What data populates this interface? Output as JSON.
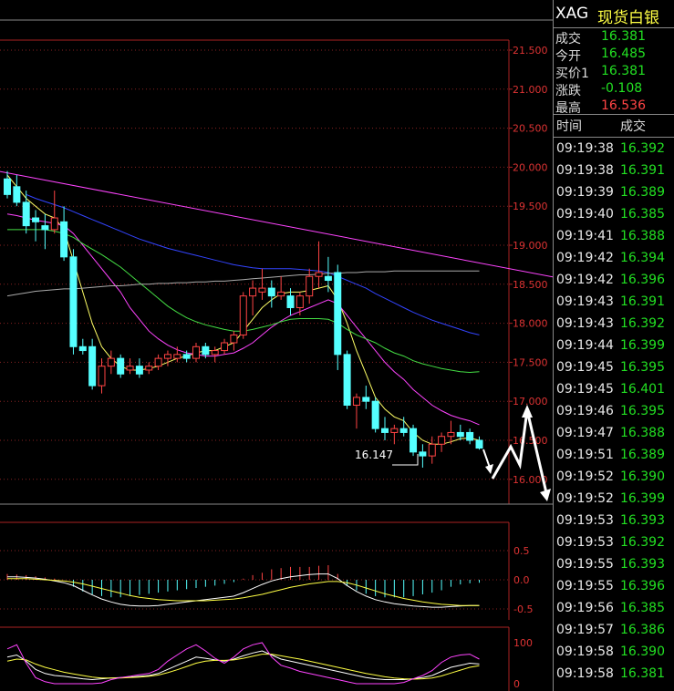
{
  "header": {
    "symbol": "XAG",
    "name": "现货白银"
  },
  "quote": [
    {
      "label": "成交",
      "value": "16.381",
      "color": "#22e022"
    },
    {
      "label": "今开",
      "value": "16.485",
      "color": "#22e022"
    },
    {
      "label": "买价1",
      "value": "16.381",
      "color": "#22e022"
    },
    {
      "label": "涨跌",
      "value": "-0.108",
      "color": "#22e022"
    },
    {
      "label": "最高",
      "value": "16.536",
      "color": "#ff4444"
    }
  ],
  "ticks_header": {
    "time": "时间",
    "price": "成交"
  },
  "ticks": [
    {
      "time": "09:19:38",
      "price": "16.392"
    },
    {
      "time": "09:19:38",
      "price": "16.391"
    },
    {
      "time": "09:19:39",
      "price": "16.389"
    },
    {
      "time": "09:19:40",
      "price": "16.385"
    },
    {
      "time": "09:19:41",
      "price": "16.388"
    },
    {
      "time": "09:19:42",
      "price": "16.394"
    },
    {
      "time": "09:19:42",
      "price": "16.396"
    },
    {
      "time": "09:19:43",
      "price": "16.391"
    },
    {
      "time": "09:19:43",
      "price": "16.392"
    },
    {
      "time": "09:19:44",
      "price": "16.399"
    },
    {
      "time": "09:19:45",
      "price": "16.395"
    },
    {
      "time": "09:19:45",
      "price": "16.401"
    },
    {
      "time": "09:19:46",
      "price": "16.395"
    },
    {
      "time": "09:19:47",
      "price": "16.388"
    },
    {
      "time": "09:19:51",
      "price": "16.389"
    },
    {
      "time": "09:19:52",
      "price": "16.390"
    },
    {
      "time": "09:19:52",
      "price": "16.399"
    },
    {
      "time": "09:19:53",
      "price": "16.393"
    },
    {
      "time": "09:19:53",
      "price": "16.392"
    },
    {
      "time": "09:19:55",
      "price": "16.393"
    },
    {
      "time": "09:19:55",
      "price": "16.396"
    },
    {
      "time": "09:19:56",
      "price": "16.385"
    },
    {
      "time": "09:19:57",
      "price": "16.386"
    },
    {
      "time": "09:19:58",
      "price": "16.390"
    },
    {
      "time": "09:19:58",
      "price": "16.381"
    }
  ],
  "chart_data": {
    "type": "candlestick",
    "yticks": [
      "21.500",
      "21.000",
      "20.500",
      "20.000",
      "19.500",
      "19.000",
      "18.500",
      "18.000",
      "17.500",
      "17.000",
      "16.500",
      "16.000"
    ],
    "ylim": [
      15.7,
      21.6
    ],
    "annotation": "16.147",
    "up_color": "#ff4444",
    "down_color": "#55ffff",
    "candles": [
      {
        "o": 19.85,
        "h": 19.95,
        "l": 19.6,
        "c": 19.65
      },
      {
        "o": 19.75,
        "h": 19.9,
        "l": 19.5,
        "c": 19.55
      },
      {
        "o": 19.55,
        "h": 19.7,
        "l": 19.15,
        "c": 19.25
      },
      {
        "o": 19.35,
        "h": 19.45,
        "l": 19.05,
        "c": 19.3
      },
      {
        "o": 19.25,
        "h": 19.4,
        "l": 18.95,
        "c": 19.2
      },
      {
        "o": 19.2,
        "h": 19.7,
        "l": 19.15,
        "c": 19.35
      },
      {
        "o": 19.3,
        "h": 19.5,
        "l": 18.8,
        "c": 18.85
      },
      {
        "o": 18.85,
        "h": 18.95,
        "l": 17.6,
        "c": 17.7
      },
      {
        "o": 17.7,
        "h": 17.8,
        "l": 17.6,
        "c": 17.65
      },
      {
        "o": 17.7,
        "h": 17.8,
        "l": 17.15,
        "c": 17.2
      },
      {
        "o": 17.2,
        "h": 17.55,
        "l": 17.1,
        "c": 17.45
      },
      {
        "o": 17.45,
        "h": 17.65,
        "l": 17.35,
        "c": 17.55
      },
      {
        "o": 17.55,
        "h": 17.6,
        "l": 17.3,
        "c": 17.35
      },
      {
        "o": 17.4,
        "h": 17.55,
        "l": 17.35,
        "c": 17.45
      },
      {
        "o": 17.45,
        "h": 17.55,
        "l": 17.3,
        "c": 17.35
      },
      {
        "o": 17.4,
        "h": 17.5,
        "l": 17.35,
        "c": 17.45
      },
      {
        "o": 17.45,
        "h": 17.6,
        "l": 17.4,
        "c": 17.55
      },
      {
        "o": 17.55,
        "h": 17.65,
        "l": 17.45,
        "c": 17.6
      },
      {
        "o": 17.55,
        "h": 17.7,
        "l": 17.5,
        "c": 17.6
      },
      {
        "o": 17.6,
        "h": 17.65,
        "l": 17.5,
        "c": 17.55
      },
      {
        "o": 17.55,
        "h": 17.75,
        "l": 17.5,
        "c": 17.7
      },
      {
        "o": 17.7,
        "h": 17.75,
        "l": 17.55,
        "c": 17.6
      },
      {
        "o": 17.6,
        "h": 17.7,
        "l": 17.5,
        "c": 17.65
      },
      {
        "o": 17.65,
        "h": 17.8,
        "l": 17.6,
        "c": 17.75
      },
      {
        "o": 17.75,
        "h": 17.9,
        "l": 17.65,
        "c": 17.85
      },
      {
        "o": 17.85,
        "h": 18.4,
        "l": 17.8,
        "c": 18.35
      },
      {
        "o": 18.35,
        "h": 18.55,
        "l": 18.1,
        "c": 18.45
      },
      {
        "o": 18.4,
        "h": 18.7,
        "l": 18.3,
        "c": 18.45
      },
      {
        "o": 18.45,
        "h": 18.55,
        "l": 18.2,
        "c": 18.35
      },
      {
        "o": 18.35,
        "h": 18.6,
        "l": 18.3,
        "c": 18.4
      },
      {
        "o": 18.35,
        "h": 18.45,
        "l": 18.1,
        "c": 18.2
      },
      {
        "o": 18.2,
        "h": 18.4,
        "l": 18.1,
        "c": 18.35
      },
      {
        "o": 18.35,
        "h": 18.7,
        "l": 18.25,
        "c": 18.6
      },
      {
        "o": 18.6,
        "h": 19.05,
        "l": 18.45,
        "c": 18.65
      },
      {
        "o": 18.6,
        "h": 18.85,
        "l": 18.4,
        "c": 18.55
      },
      {
        "o": 18.65,
        "h": 18.75,
        "l": 17.4,
        "c": 17.6
      },
      {
        "o": 17.6,
        "h": 17.65,
        "l": 16.9,
        "c": 16.95
      },
      {
        "o": 16.95,
        "h": 17.1,
        "l": 16.65,
        "c": 17.05
      },
      {
        "o": 17.05,
        "h": 17.2,
        "l": 16.9,
        "c": 17.0
      },
      {
        "o": 17.0,
        "h": 17.05,
        "l": 16.6,
        "c": 16.65
      },
      {
        "o": 16.65,
        "h": 16.8,
        "l": 16.5,
        "c": 16.6
      },
      {
        "o": 16.6,
        "h": 16.7,
        "l": 16.45,
        "c": 16.65
      },
      {
        "o": 16.65,
        "h": 16.8,
        "l": 16.55,
        "c": 16.6
      },
      {
        "o": 16.65,
        "h": 16.7,
        "l": 16.3,
        "c": 16.35
      },
      {
        "o": 16.35,
        "h": 16.45,
        "l": 16.15,
        "c": 16.3
      },
      {
        "o": 16.3,
        "h": 16.55,
        "l": 16.2,
        "c": 16.45
      },
      {
        "o": 16.45,
        "h": 16.6,
        "l": 16.35,
        "c": 16.55
      },
      {
        "o": 16.55,
        "h": 16.75,
        "l": 16.45,
        "c": 16.6
      },
      {
        "o": 16.6,
        "h": 16.7,
        "l": 16.5,
        "c": 16.55
      },
      {
        "o": 16.6,
        "h": 16.65,
        "l": 16.45,
        "c": 16.5
      },
      {
        "o": 16.5,
        "h": 16.55,
        "l": 16.38,
        "c": 16.4
      }
    ],
    "ma": [
      {
        "color": "#ffff66",
        "values": [
          19.9,
          19.75,
          19.6,
          19.5,
          19.4,
          19.35,
          19.2,
          18.8,
          18.4,
          18.0,
          17.7,
          17.55,
          17.45,
          17.4,
          17.4,
          17.42,
          17.45,
          17.5,
          17.55,
          17.58,
          17.62,
          17.65,
          17.65,
          17.7,
          17.75,
          17.9,
          18.05,
          18.2,
          18.3,
          18.38,
          18.4,
          18.4,
          18.42,
          18.45,
          18.48,
          18.3,
          18.0,
          17.65,
          17.35,
          17.05,
          16.9,
          16.8,
          16.75,
          16.6,
          16.5,
          16.45,
          16.45,
          16.48,
          16.52,
          16.53,
          16.5
        ]
      },
      {
        "color": "#ff44ff",
        "values": [
          19.4,
          19.38,
          19.35,
          19.32,
          19.3,
          19.28,
          19.25,
          19.15,
          19.0,
          18.85,
          18.7,
          18.55,
          18.4,
          18.2,
          18.05,
          17.9,
          17.8,
          17.72,
          17.66,
          17.62,
          17.6,
          17.58,
          17.58,
          17.6,
          17.62,
          17.68,
          17.75,
          17.85,
          17.95,
          18.03,
          18.1,
          18.15,
          18.2,
          18.25,
          18.3,
          18.25,
          18.1,
          17.95,
          17.8,
          17.65,
          17.5,
          17.38,
          17.28,
          17.15,
          17.05,
          16.95,
          16.88,
          16.82,
          16.78,
          16.75,
          16.7
        ]
      },
      {
        "color": "#44dd44",
        "values": [
          19.2,
          19.2,
          19.2,
          19.2,
          19.2,
          19.18,
          19.15,
          19.1,
          19.02,
          18.95,
          18.88,
          18.8,
          18.72,
          18.62,
          18.52,
          18.42,
          18.32,
          18.22,
          18.14,
          18.07,
          18.02,
          17.98,
          17.95,
          17.92,
          17.9,
          17.9,
          17.92,
          17.95,
          17.98,
          18.02,
          18.05,
          18.06,
          18.06,
          18.06,
          18.05,
          18.0,
          17.92,
          17.85,
          17.8,
          17.75,
          17.68,
          17.62,
          17.58,
          17.52,
          17.48,
          17.45,
          17.42,
          17.4,
          17.38,
          17.37,
          17.38
        ]
      },
      {
        "color": "#3344ff",
        "values": [
          null,
          null,
          19.65,
          19.6,
          19.56,
          19.52,
          19.48,
          19.43,
          19.38,
          19.33,
          19.28,
          19.23,
          19.18,
          19.13,
          19.08,
          19.04,
          19.0,
          18.96,
          18.93,
          18.9,
          18.87,
          18.84,
          18.81,
          18.78,
          18.75,
          18.73,
          18.71,
          18.7,
          18.7,
          18.7,
          18.7,
          18.69,
          18.68,
          18.67,
          18.65,
          18.6,
          18.55,
          18.5,
          18.45,
          18.38,
          18.32,
          18.26,
          18.2,
          18.14,
          18.09,
          18.04,
          18.0,
          17.96,
          17.92,
          17.88,
          17.85
        ]
      },
      {
        "color": "#aaaaaa",
        "values": [
          18.35,
          18.37,
          18.39,
          18.41,
          18.42,
          18.43,
          18.44,
          18.44,
          18.45,
          18.46,
          18.47,
          18.48,
          18.48,
          18.49,
          18.5,
          18.5,
          18.51,
          18.51,
          18.52,
          18.52,
          18.53,
          18.53,
          18.54,
          18.54,
          18.55,
          18.56,
          18.57,
          18.58,
          18.59,
          18.6,
          18.61,
          18.62,
          18.62,
          18.63,
          18.64,
          18.64,
          18.65,
          18.65,
          18.66,
          18.66,
          18.66,
          18.67,
          18.67,
          18.67,
          18.67,
          18.67,
          18.67,
          18.67,
          18.67,
          18.67,
          18.67
        ]
      }
    ],
    "trendline": {
      "color": "#ff44ff",
      "points": [
        [
          -1,
          19.95
        ],
        [
          64,
          18.45
        ]
      ]
    },
    "macd": {
      "yticks": [
        "0.5",
        "0.0",
        "-0.5"
      ],
      "ylim": [
        -0.6,
        0.65
      ],
      "hist": [
        0.1,
        0.09,
        0.08,
        0.06,
        0.04,
        0.02,
        0.0,
        -0.12,
        -0.2,
        -0.25,
        -0.28,
        -0.3,
        -0.3,
        -0.28,
        -0.26,
        -0.24,
        -0.22,
        -0.2,
        -0.18,
        -0.16,
        -0.14,
        -0.12,
        -0.1,
        -0.07,
        -0.04,
        0.02,
        0.08,
        0.12,
        0.18,
        0.2,
        0.22,
        0.22,
        0.22,
        0.24,
        0.25,
        0.1,
        -0.1,
        -0.18,
        -0.24,
        -0.28,
        -0.3,
        -0.3,
        -0.3,
        -0.28,
        -0.25,
        -0.22,
        -0.18,
        -0.12,
        -0.08,
        -0.06,
        -0.05
      ],
      "dif": [
        0.05,
        0.05,
        0.04,
        0.03,
        0.01,
        -0.02,
        -0.05,
        -0.1,
        -0.18,
        -0.26,
        -0.33,
        -0.38,
        -0.42,
        -0.44,
        -0.45,
        -0.45,
        -0.44,
        -0.42,
        -0.4,
        -0.38,
        -0.36,
        -0.34,
        -0.32,
        -0.3,
        -0.28,
        -0.22,
        -0.15,
        -0.08,
        -0.02,
        0.02,
        0.05,
        0.07,
        0.09,
        0.1,
        0.1,
        0.02,
        -0.1,
        -0.2,
        -0.28,
        -0.34,
        -0.38,
        -0.41,
        -0.43,
        -0.45,
        -0.46,
        -0.47,
        -0.47,
        -0.46,
        -0.45,
        -0.44,
        -0.44
      ],
      "dea": [
        0.02,
        0.02,
        0.02,
        0.01,
        0.0,
        -0.01,
        -0.02,
        -0.04,
        -0.07,
        -0.11,
        -0.15,
        -0.19,
        -0.23,
        -0.27,
        -0.3,
        -0.32,
        -0.34,
        -0.35,
        -0.36,
        -0.36,
        -0.36,
        -0.36,
        -0.35,
        -0.34,
        -0.33,
        -0.31,
        -0.28,
        -0.25,
        -0.21,
        -0.17,
        -0.13,
        -0.1,
        -0.07,
        -0.05,
        -0.03,
        -0.03,
        -0.05,
        -0.09,
        -0.14,
        -0.19,
        -0.24,
        -0.28,
        -0.32,
        -0.35,
        -0.38,
        -0.4,
        -0.42,
        -0.43,
        -0.44,
        -0.44,
        -0.44
      ]
    },
    "kdj": {
      "yticks": [
        "100",
        "0"
      ],
      "ylim": [
        -5,
        110
      ],
      "k": [
        65,
        70,
        55,
        35,
        25,
        20,
        18,
        15,
        12,
        10,
        12,
        14,
        15,
        16,
        18,
        20,
        25,
        35,
        45,
        55,
        65,
        62,
        58,
        55,
        60,
        68,
        75,
        80,
        70,
        60,
        55,
        50,
        45,
        40,
        35,
        30,
        25,
        20,
        15,
        12,
        10,
        10,
        10,
        12,
        15,
        20,
        30,
        40,
        45,
        50,
        48
      ],
      "d": [
        55,
        60,
        58,
        48,
        40,
        34,
        28,
        24,
        20,
        16,
        14,
        14,
        14,
        15,
        16,
        18,
        21,
        27,
        34,
        42,
        50,
        55,
        57,
        57,
        58,
        62,
        67,
        72,
        72,
        68,
        64,
        60,
        55,
        50,
        45,
        40,
        35,
        30,
        25,
        21,
        17,
        14,
        12,
        11,
        12,
        14,
        19,
        26,
        33,
        40,
        44
      ],
      "j": [
        85,
        95,
        50,
        15,
        5,
        0,
        0,
        0,
        0,
        0,
        2,
        10,
        15,
        18,
        22,
        25,
        35,
        55,
        70,
        85,
        95,
        80,
        62,
        50,
        65,
        85,
        95,
        100,
        65,
        45,
        38,
        30,
        25,
        20,
        15,
        10,
        5,
        0,
        0,
        0,
        0,
        0,
        3,
        12,
        20,
        32,
        52,
        65,
        70,
        72,
        60
      ]
    }
  }
}
